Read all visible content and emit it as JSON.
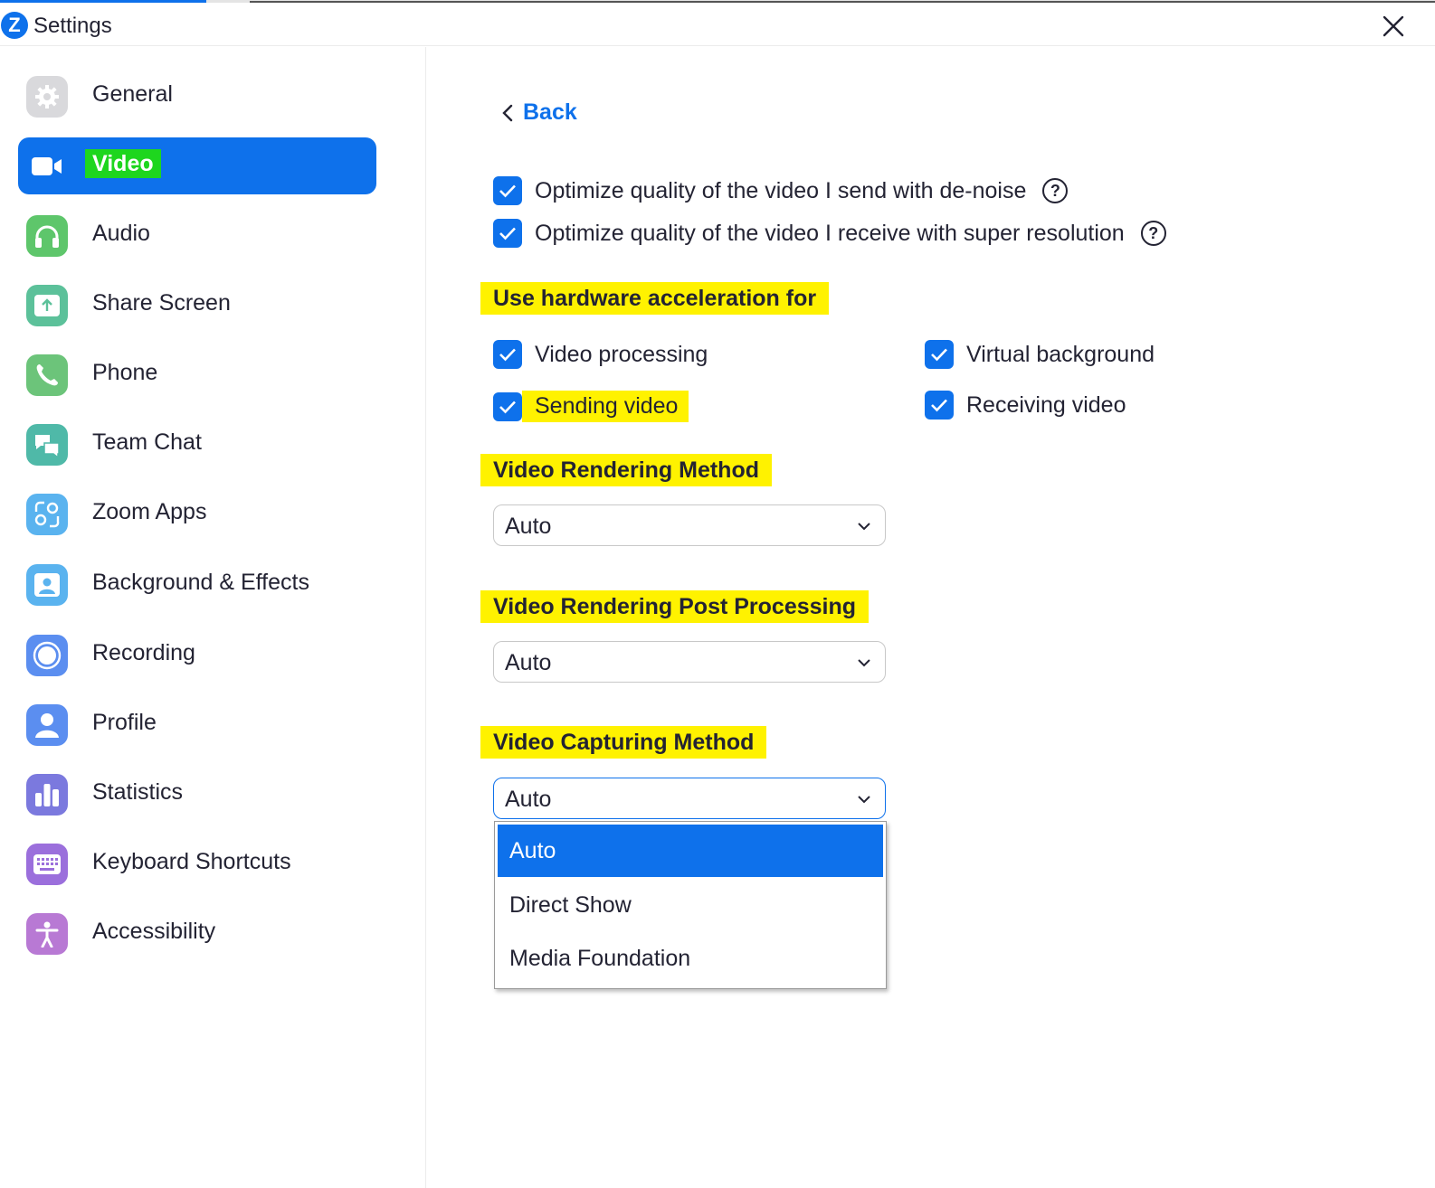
{
  "window": {
    "title": "Settings",
    "logo_letter": "Z"
  },
  "colors": {
    "accent": "#0e71eb",
    "highlight_yellow": "#fff200",
    "highlight_green": "#1ed61e"
  },
  "sidebar": {
    "items": [
      {
        "label": "General",
        "icon": "gear-icon"
      },
      {
        "label": "Video",
        "icon": "video-camera-icon",
        "active": true
      },
      {
        "label": "Audio",
        "icon": "headphones-icon"
      },
      {
        "label": "Share Screen",
        "icon": "share-screen-icon"
      },
      {
        "label": "Phone",
        "icon": "phone-icon"
      },
      {
        "label": "Team Chat",
        "icon": "chat-icon"
      },
      {
        "label": "Zoom Apps",
        "icon": "apps-icon"
      },
      {
        "label": "Background & Effects",
        "icon": "background-icon"
      },
      {
        "label": "Recording",
        "icon": "recording-icon"
      },
      {
        "label": "Profile",
        "icon": "profile-icon"
      },
      {
        "label": "Statistics",
        "icon": "statistics-icon"
      },
      {
        "label": "Keyboard Shortcuts",
        "icon": "keyboard-icon"
      },
      {
        "label": "Accessibility",
        "icon": "accessibility-icon"
      }
    ]
  },
  "main": {
    "back_label": "Back",
    "options": [
      {
        "label": "Optimize quality of the video I send with de-noise",
        "checked": true
      },
      {
        "label": "Optimize quality of the video I receive with super resolution",
        "checked": true
      }
    ],
    "hw_accel": {
      "heading": "Use hardware acceleration for",
      "items": [
        {
          "label": "Video processing",
          "checked": true
        },
        {
          "label": "Virtual background",
          "checked": true
        },
        {
          "label": "Sending video",
          "checked": true
        },
        {
          "label": "Receiving video",
          "checked": true
        }
      ]
    },
    "rendering_method": {
      "heading": "Video Rendering Method",
      "value": "Auto"
    },
    "post_processing": {
      "heading": "Video Rendering Post Processing",
      "value": "Auto"
    },
    "capturing_method": {
      "heading": "Video Capturing Method",
      "value": "Auto",
      "options": [
        "Auto",
        "Direct Show",
        "Media Foundation"
      ]
    },
    "help_glyph": "?"
  }
}
